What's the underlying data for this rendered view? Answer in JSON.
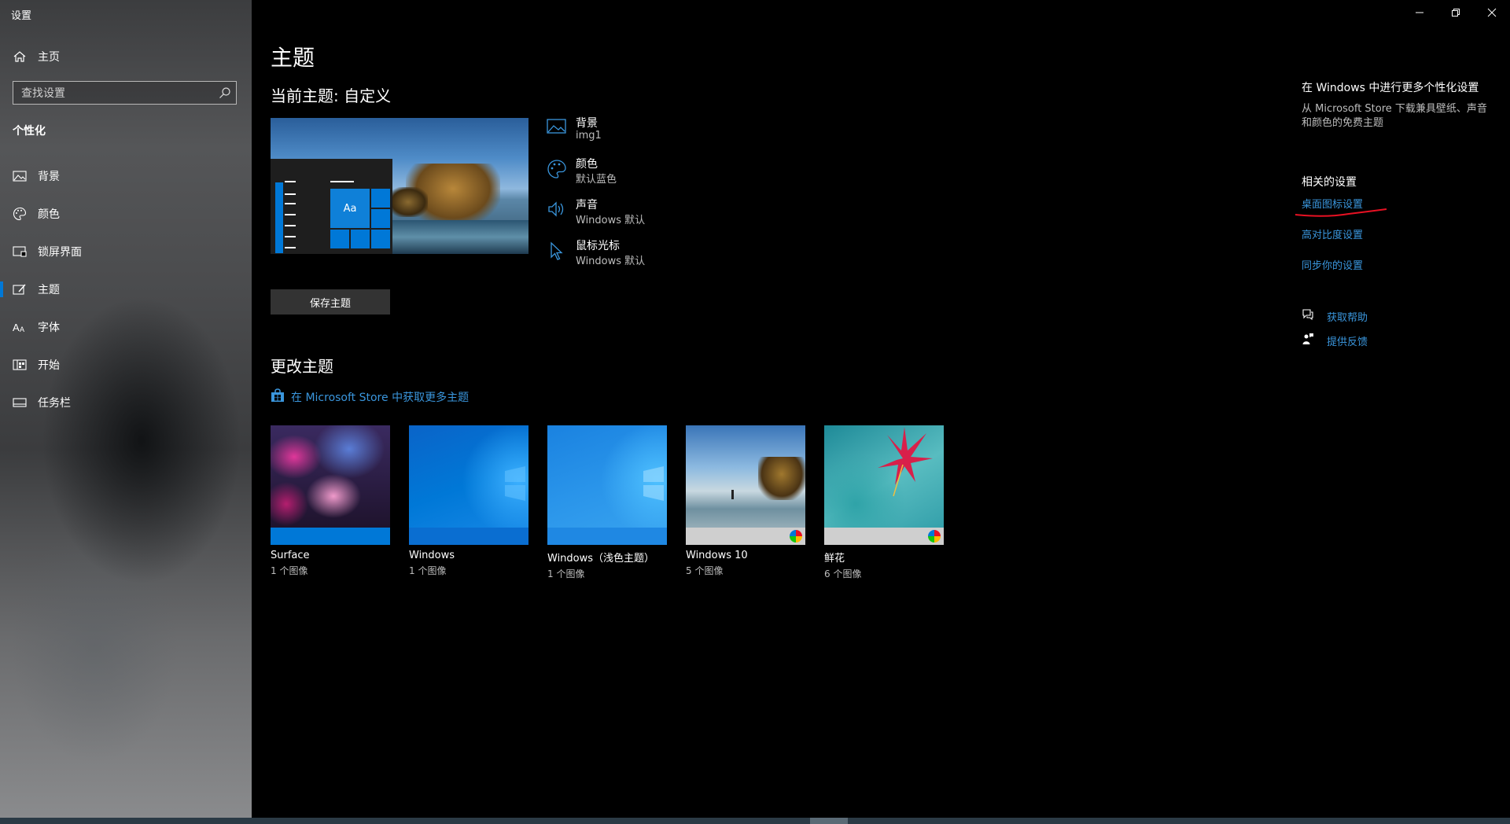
{
  "window": {
    "title": "设置",
    "controls": {
      "minimize": "minimize-icon",
      "restore": "restore-icon",
      "close": "close-icon"
    }
  },
  "sidebar": {
    "home_label": "主页",
    "search_placeholder": "查找设置",
    "section_heading": "个性化",
    "items": [
      {
        "label": "背景",
        "icon": "image-icon"
      },
      {
        "label": "颜色",
        "icon": "palette-icon"
      },
      {
        "label": "锁屏界面",
        "icon": "lock-screen-icon"
      },
      {
        "label": "主题",
        "icon": "theme-icon",
        "active": true
      },
      {
        "label": "字体",
        "icon": "font-icon"
      },
      {
        "label": "开始",
        "icon": "start-icon"
      },
      {
        "label": "任务栏",
        "icon": "taskbar-icon"
      }
    ]
  },
  "main": {
    "title": "主题",
    "current_theme": "当前主题: 自定义",
    "preview_tile_text": "Aa",
    "properties": [
      {
        "name": "背景",
        "value": "img1",
        "icon": "image-icon"
      },
      {
        "name": "颜色",
        "value": "默认蓝色",
        "icon": "palette-icon"
      },
      {
        "name": "声音",
        "value": "Windows 默认",
        "icon": "speaker-icon"
      },
      {
        "name": "鼠标光标",
        "value": "Windows 默认",
        "icon": "cursor-icon"
      }
    ],
    "save_button": "保存主题",
    "change_theme_heading": "更改主题",
    "store_link": "在 Microsoft Store 中获取更多主题",
    "themes": [
      {
        "name": "Surface",
        "count": "1 个图像"
      },
      {
        "name": "Windows",
        "count": "1 个图像"
      },
      {
        "name": "Windows（浅色主题）",
        "count": "1 个图像"
      },
      {
        "name": "Windows 10",
        "count": "5 个图像"
      },
      {
        "name": "鲜花",
        "count": "6 个图像"
      }
    ]
  },
  "right": {
    "heading": "在 Windows 中进行更多个性化设置",
    "description": "从 Microsoft Store 下载兼具壁纸、声音和颜色的免费主题",
    "related_heading": "相关的设置",
    "related_links": [
      "桌面图标设置",
      "高对比度设置",
      "同步你的设置"
    ],
    "help": [
      {
        "label": "获取帮助",
        "icon": "help-chat-icon"
      },
      {
        "label": "提供反馈",
        "icon": "feedback-icon"
      }
    ]
  },
  "colors": {
    "accent": "#0078d7",
    "link": "#3a96dd",
    "annotation": "#e81123"
  }
}
